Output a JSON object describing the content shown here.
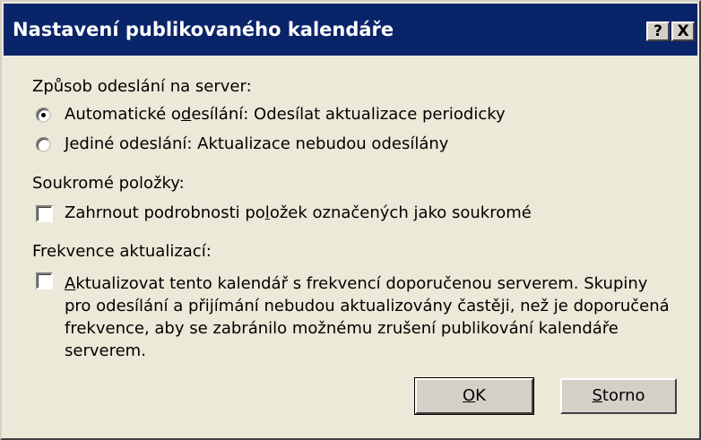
{
  "window": {
    "title": "Nastavení publikovaného kalendáře",
    "help_button": "?",
    "close_button": "X"
  },
  "upload_method": {
    "label": "Způsob odeslání na server:",
    "options": [
      {
        "pre": "Automatické o",
        "accel": "d",
        "post": "esílání: Odesílat aktualizace periodicky",
        "checked": true
      },
      {
        "pre": "",
        "accel": "J",
        "post": "ediné odeslání: Aktualizace nebudou odesílány",
        "checked": false
      }
    ]
  },
  "private_items": {
    "label": "Soukromé položky:",
    "checkbox": {
      "pre": "Zahrnout podrobnosti po",
      "accel": "l",
      "post": "ožek označených jako soukromé",
      "checked": false
    }
  },
  "update_frequency": {
    "label": "Frekvence aktualizací:",
    "checkbox": {
      "checked": false,
      "accel": "A",
      "line1_rest": "ktualizovat tento kalendář s frekvencí doporučenou serverem. Skupiny",
      "line2": "pro odesílání a přijímání nebudou aktualizovány častěji, než je doporučená",
      "line3": "frekvence, aby se zabránilo možnému zrušení publikování kalendáře",
      "line4": "serverem."
    }
  },
  "buttons": {
    "ok_accel": "O",
    "ok_rest": "K",
    "cancel_accel": "S",
    "cancel_rest": "torno"
  }
}
